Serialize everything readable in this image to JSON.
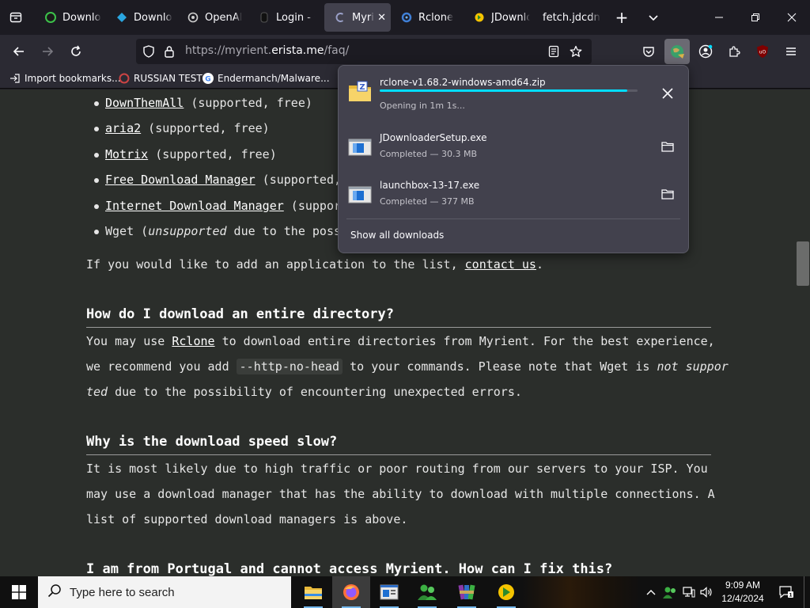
{
  "tabs": [
    {
      "title": "Download",
      "icon": "green-circle-icon",
      "active": false
    },
    {
      "title": "Download",
      "icon": "blue-diamond-icon",
      "active": false
    },
    {
      "title": "OpenAI",
      "icon": "openai-icon",
      "active": false
    },
    {
      "title": "Login - C",
      "icon": "dark-logo-icon",
      "active": false
    },
    {
      "title": "Myrient",
      "icon": "myrient-icon",
      "active": true
    },
    {
      "title": "Rclone",
      "icon": "rclone-icon",
      "active": false
    },
    {
      "title": "JDownload",
      "icon": "jdownloader-icon",
      "active": false
    },
    {
      "title": "fetch.jdcdn.c",
      "icon": "",
      "active": false
    }
  ],
  "url": {
    "prefix": "https://myrient.",
    "domain": "erista.me",
    "path": "/faq/"
  },
  "bookmarks": [
    {
      "label": "Import bookmarks...",
      "icon": "import-icon"
    },
    {
      "label": "RUSSIAN TEST",
      "icon": "rt-icon"
    },
    {
      "label": "Endermanch/Malware...",
      "icon": "github-icon"
    }
  ],
  "page": {
    "list": [
      {
        "link": "DownThemAll",
        "rest": " (supported, free)"
      },
      {
        "link": "aria2",
        "rest": " (supported, free)"
      },
      {
        "link": "Motrix",
        "rest": " (supported, free)"
      },
      {
        "link": "Free Download Manager",
        "rest": " (supported,"
      },
      {
        "link": "Internet Download Manager",
        "rest": " (suppor"
      },
      {
        "plain": "Wget (",
        "italic": "unsupported",
        "rest": " due to the poss"
      }
    ],
    "add_app": {
      "pre": "If you would like to add an application to the list, ",
      "link": "contact us",
      "post": "."
    },
    "q1": {
      "heading": "How do I download an entire directory?",
      "l1_pre": "You may use ",
      "l1_link": "Rclone",
      "l1_post": " to download entire directories from Myrient. For the best experience,",
      "l2_pre": "we recommend you add ",
      "l2_code": "--http-no-head",
      "l2_post": " to your commands. Please note that Wget is ",
      "l2_italic": "not suppor",
      "l3_italic": "ted",
      "l3_post": " due to the possibility of encountering unexpected errors."
    },
    "q2": {
      "heading": "Why is the download speed slow?",
      "l1": "It is most likely due to high traffic or poor routing from our servers to your ISP. You",
      "l2": "may use a download manager that has the ability to download with multiple connections. A",
      "l3": "list of supported download managers is above."
    },
    "q3": {
      "heading": "I am from Portugal and cannot access Myrient. How can I fix this?"
    }
  },
  "downloads": {
    "items": [
      {
        "name": "rclone-v1.68.2-windows-amd64.zip",
        "status": "Opening in 1m 1s...",
        "progress_percent": 96,
        "icon": "zip-folder-icon",
        "action_icon": "cancel-icon"
      },
      {
        "name": "JDownloaderSetup.exe",
        "status": "Completed — 30.3 MB",
        "icon": "exe-file-icon",
        "action_icon": "folder-icon"
      },
      {
        "name": "launchbox-13-17.exe",
        "status": "Completed — 377 MB",
        "icon": "exe-file-icon",
        "action_icon": "folder-icon"
      }
    ],
    "show_all": "Show all downloads"
  },
  "taskbar": {
    "search_placeholder": "Type here to search",
    "time": "9:09 AM",
    "date": "12/4/2024"
  },
  "colors": {
    "accent": "#00ddff",
    "page_bg": "#2b2e2b",
    "panel_bg": "#42414d"
  }
}
